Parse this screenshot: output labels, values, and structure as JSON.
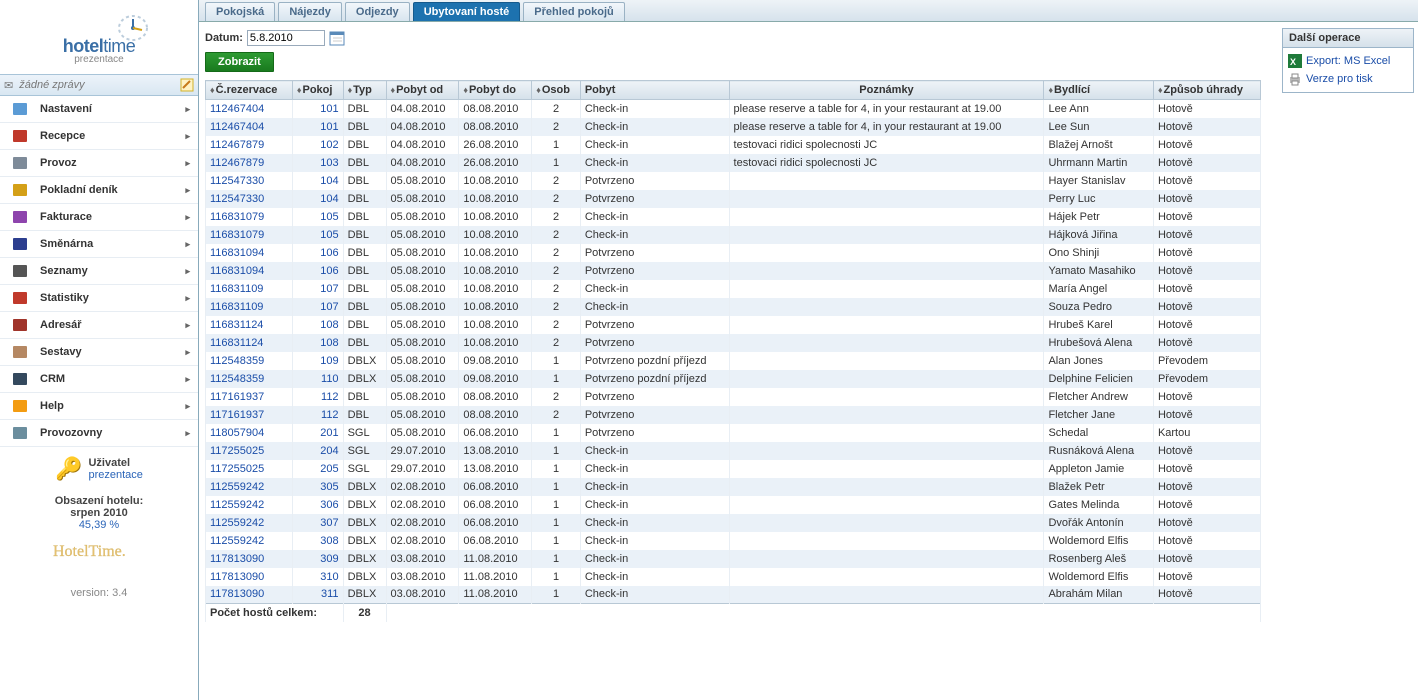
{
  "brand": {
    "name_bold": "hotel",
    "name_light": "time",
    "sub": "prezentace"
  },
  "msgbar": {
    "text": "žádné zprávy"
  },
  "menu": [
    {
      "label": "Nastavení",
      "icon": "gear",
      "color": "#5b9bd5"
    },
    {
      "label": "Recepce",
      "icon": "book",
      "color": "#c0392b"
    },
    {
      "label": "Provoz",
      "icon": "gear2",
      "color": "#7e8b99"
    },
    {
      "label": "Pokladní deník",
      "icon": "cash",
      "color": "#d4a017"
    },
    {
      "label": "Fakturace",
      "icon": "invoice",
      "color": "#8e44ad"
    },
    {
      "label": "Směnárna",
      "icon": "exchange",
      "color": "#2c3e8f"
    },
    {
      "label": "Seznamy",
      "icon": "list",
      "color": "#555"
    },
    {
      "label": "Statistiky",
      "icon": "stats",
      "color": "#c0392b"
    },
    {
      "label": "Adresář",
      "icon": "addrbook",
      "color": "#a0342a"
    },
    {
      "label": "Sestavy",
      "icon": "reports",
      "color": "#b58863"
    },
    {
      "label": "CRM",
      "icon": "crm",
      "color": "#34495e"
    },
    {
      "label": "Help",
      "icon": "help",
      "color": "#f39c12"
    },
    {
      "label": "Provozovny",
      "icon": "building",
      "color": "#6b8e9e"
    }
  ],
  "user": {
    "title": "Uživatel",
    "name": "prezentace"
  },
  "occupancy": {
    "title": "Obsazení hotelu:",
    "period": "srpen 2010",
    "value": "45,39 %"
  },
  "version": "version: 3.4",
  "tabs": [
    "Pokojská",
    "Nájezdy",
    "Odjezdy",
    "Ubytovaní hosté",
    "Přehled pokojů"
  ],
  "active_tab": 3,
  "filter": {
    "label": "Datum:",
    "value": "5.8.2010"
  },
  "showbtn": "Zobrazit",
  "headers": [
    "Č.rezervace",
    "Pokoj",
    "Typ",
    "Pobyt od",
    "Pobyt do",
    "Osob",
    "Pobyt",
    "Poznámky",
    "Bydlící",
    "Způsob úhrady"
  ],
  "sortable": [
    true,
    true,
    true,
    true,
    true,
    true,
    false,
    false,
    true,
    true
  ],
  "rows": [
    [
      "112467404",
      "101",
      "DBL",
      "04.08.2010",
      "08.08.2010",
      "2",
      "Check-in",
      "please reserve a table for 4, in your restaurant at 19.00",
      "Lee Ann",
      "Hotově"
    ],
    [
      "112467404",
      "101",
      "DBL",
      "04.08.2010",
      "08.08.2010",
      "2",
      "Check-in",
      "please reserve a table for 4, in your restaurant at 19.00",
      "Lee Sun",
      "Hotově"
    ],
    [
      "112467879",
      "102",
      "DBL",
      "04.08.2010",
      "26.08.2010",
      "1",
      "Check-in",
      "testovaci ridici spolecnosti JC",
      "Blažej Arnošt",
      "Hotově"
    ],
    [
      "112467879",
      "103",
      "DBL",
      "04.08.2010",
      "26.08.2010",
      "1",
      "Check-in",
      "testovaci ridici spolecnosti JC",
      "Uhrmann Martin",
      "Hotově"
    ],
    [
      "112547330",
      "104",
      "DBL",
      "05.08.2010",
      "10.08.2010",
      "2",
      "Potvrzeno",
      "",
      "Hayer Stanislav",
      "Hotově"
    ],
    [
      "112547330",
      "104",
      "DBL",
      "05.08.2010",
      "10.08.2010",
      "2",
      "Potvrzeno",
      "",
      "Perry Luc",
      "Hotově"
    ],
    [
      "116831079",
      "105",
      "DBL",
      "05.08.2010",
      "10.08.2010",
      "2",
      "Check-in",
      "",
      "Hájek Petr",
      "Hotově"
    ],
    [
      "116831079",
      "105",
      "DBL",
      "05.08.2010",
      "10.08.2010",
      "2",
      "Check-in",
      "",
      "Hájková Jiřina",
      "Hotově"
    ],
    [
      "116831094",
      "106",
      "DBL",
      "05.08.2010",
      "10.08.2010",
      "2",
      "Potvrzeno",
      "",
      "Ono Shinji",
      "Hotově"
    ],
    [
      "116831094",
      "106",
      "DBL",
      "05.08.2010",
      "10.08.2010",
      "2",
      "Potvrzeno",
      "",
      "Yamato Masahiko",
      "Hotově"
    ],
    [
      "116831109",
      "107",
      "DBL",
      "05.08.2010",
      "10.08.2010",
      "2",
      "Check-in",
      "",
      "María Angel",
      "Hotově"
    ],
    [
      "116831109",
      "107",
      "DBL",
      "05.08.2010",
      "10.08.2010",
      "2",
      "Check-in",
      "",
      "Souza Pedro",
      "Hotově"
    ],
    [
      "116831124",
      "108",
      "DBL",
      "05.08.2010",
      "10.08.2010",
      "2",
      "Potvrzeno",
      "",
      "Hrubeš Karel",
      "Hotově"
    ],
    [
      "116831124",
      "108",
      "DBL",
      "05.08.2010",
      "10.08.2010",
      "2",
      "Potvrzeno",
      "",
      "Hrubešová Alena",
      "Hotově"
    ],
    [
      "112548359",
      "109",
      "DBLX",
      "05.08.2010",
      "09.08.2010",
      "1",
      "Potvrzeno pozdní příjezd",
      "",
      "Alan Jones",
      "Převodem"
    ],
    [
      "112548359",
      "110",
      "DBLX",
      "05.08.2010",
      "09.08.2010",
      "1",
      "Potvrzeno pozdní příjezd",
      "",
      "Delphine Felicien",
      "Převodem"
    ],
    [
      "117161937",
      "112",
      "DBL",
      "05.08.2010",
      "08.08.2010",
      "2",
      "Potvrzeno",
      "",
      "Fletcher Andrew",
      "Hotově"
    ],
    [
      "117161937",
      "112",
      "DBL",
      "05.08.2010",
      "08.08.2010",
      "2",
      "Potvrzeno",
      "",
      "Fletcher Jane",
      "Hotově"
    ],
    [
      "118057904",
      "201",
      "SGL",
      "05.08.2010",
      "06.08.2010",
      "1",
      "Potvrzeno",
      "",
      "Schedal",
      "Kartou"
    ],
    [
      "117255025",
      "204",
      "SGL",
      "29.07.2010",
      "13.08.2010",
      "1",
      "Check-in",
      "",
      "Rusnáková Alena",
      "Hotově"
    ],
    [
      "117255025",
      "205",
      "SGL",
      "29.07.2010",
      "13.08.2010",
      "1",
      "Check-in",
      "",
      "Appleton Jamie",
      "Hotově"
    ],
    [
      "112559242",
      "305",
      "DBLX",
      "02.08.2010",
      "06.08.2010",
      "1",
      "Check-in",
      "",
      "Blažek Petr",
      "Hotově"
    ],
    [
      "112559242",
      "306",
      "DBLX",
      "02.08.2010",
      "06.08.2010",
      "1",
      "Check-in",
      "",
      "Gates Melinda",
      "Hotově"
    ],
    [
      "112559242",
      "307",
      "DBLX",
      "02.08.2010",
      "06.08.2010",
      "1",
      "Check-in",
      "",
      "Dvořák Antonín",
      "Hotově"
    ],
    [
      "112559242",
      "308",
      "DBLX",
      "02.08.2010",
      "06.08.2010",
      "1",
      "Check-in",
      "",
      "Woldemord Elfis",
      "Hotově"
    ],
    [
      "117813090",
      "309",
      "DBLX",
      "03.08.2010",
      "11.08.2010",
      "1",
      "Check-in",
      "",
      "Rosenberg Aleš",
      "Hotově"
    ],
    [
      "117813090",
      "310",
      "DBLX",
      "03.08.2010",
      "11.08.2010",
      "1",
      "Check-in",
      "",
      "Woldemord Elfis",
      "Hotově"
    ],
    [
      "117813090",
      "311",
      "DBLX",
      "03.08.2010",
      "11.08.2010",
      "1",
      "Check-in",
      "",
      "Abrahám Milan",
      "Hotově"
    ]
  ],
  "footer": {
    "label": "Počet hostů celkem:",
    "value": "28"
  },
  "ops": {
    "title": "Další operace",
    "excel": "Export: MS Excel",
    "print": "Verze pro tisk"
  }
}
